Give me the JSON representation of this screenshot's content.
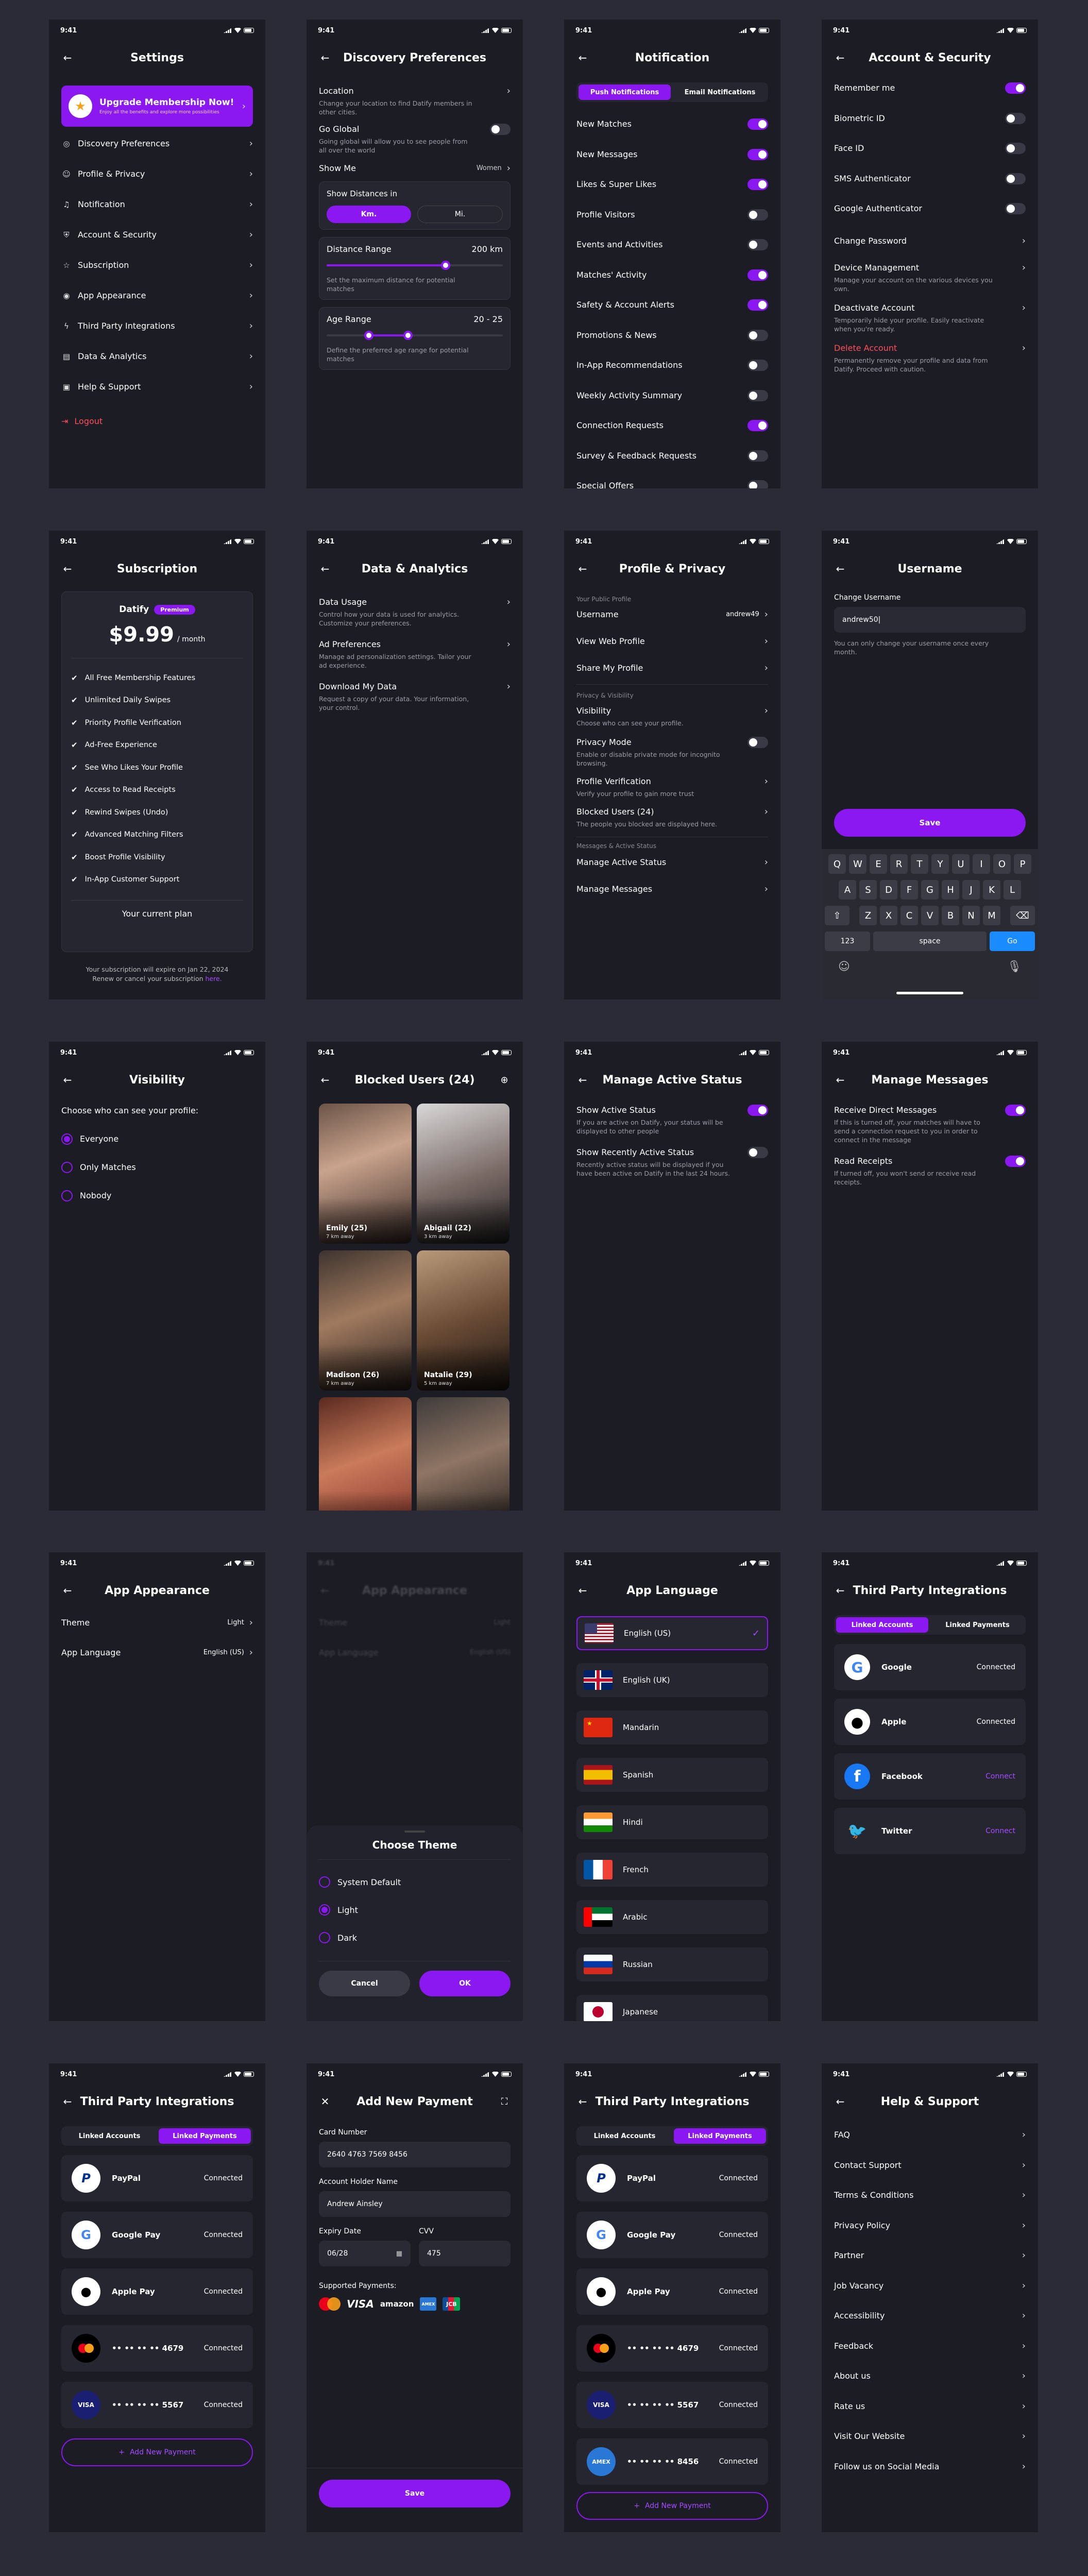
{
  "status_time": "9:41",
  "s1": {
    "title": "Settings",
    "promo_title": "Upgrade Membership Now!",
    "promo_sub": "Enjoy all the benefits and explore more possibilities",
    "items": [
      {
        "label": "Discovery Preferences",
        "icon": "compass-icon"
      },
      {
        "label": "Profile & Privacy",
        "icon": "user-icon"
      },
      {
        "label": "Notification",
        "icon": "bell-icon"
      },
      {
        "label": "Account & Security",
        "icon": "shield-icon"
      },
      {
        "label": "Subscription",
        "icon": "star-icon"
      },
      {
        "label": "App Appearance",
        "icon": "eye-icon"
      },
      {
        "label": "Third Party Integrations",
        "icon": "bolt-icon"
      },
      {
        "label": "Data & Analytics",
        "icon": "chart-icon"
      },
      {
        "label": "Help & Support",
        "icon": "doc-icon"
      }
    ],
    "logout": "Logout"
  },
  "s2": {
    "title": "Discovery Preferences",
    "loc_label": "Location",
    "loc_sub": "Change your location to find Datify members in other cities.",
    "global_label": "Go Global",
    "global_sub": "Going global will allow you to see people from all over the world",
    "showme_label": "Show Me",
    "showme_value": "Women",
    "dist_title": "Show Distances in",
    "km": "Km.",
    "mi": "Mi.",
    "range_label": "Distance Range",
    "range_value": "200 km",
    "range_sub": "Set the maximum distance for potential matches",
    "range_fill": 0.73,
    "age_label": "Age Range",
    "age_value": "20 - 25",
    "age_sub": "Define the preferred age range for potential matches",
    "age_lo": 0.26,
    "age_hi": 0.5
  },
  "s3": {
    "title": "Notification",
    "tab_push": "Push Notifications",
    "tab_email": "Email Notifications",
    "items": [
      {
        "label": "New Matches",
        "on": true
      },
      {
        "label": "New Messages",
        "on": true
      },
      {
        "label": "Likes & Super Likes",
        "on": true
      },
      {
        "label": "Profile Visitors",
        "on": false
      },
      {
        "label": "Events and Activities",
        "on": false
      },
      {
        "label": "Matches' Activity",
        "on": true
      },
      {
        "label": "Safety & Account Alerts",
        "on": true
      },
      {
        "label": "Promotions & News",
        "on": false
      },
      {
        "label": "In-App Recommendations",
        "on": false
      },
      {
        "label": "Weekly Activity Summary",
        "on": false
      },
      {
        "label": "Connection Requests",
        "on": true
      },
      {
        "label": "Survey & Feedback Requests",
        "on": false
      },
      {
        "label": "Special Offers",
        "on": false
      }
    ]
  },
  "s4": {
    "title": "Account & Security",
    "toggles": [
      {
        "label": "Remember me",
        "on": true
      },
      {
        "label": "Biometric ID",
        "on": false
      },
      {
        "label": "Face ID",
        "on": false
      },
      {
        "label": "SMS Authenticator",
        "on": false
      },
      {
        "label": "Google Authenticator",
        "on": false
      }
    ],
    "change_pw": "Change Password",
    "device_label": "Device Management",
    "device_sub": "Manage your account on the various devices you own.",
    "deact_label": "Deactivate Account",
    "deact_sub": "Temporarily hide your profile. Easily reactivate when you're ready.",
    "delete_label": "Delete Account",
    "delete_sub": "Permanently remove your profile and data from Datify. Proceed with caution."
  },
  "s5": {
    "title": "Subscription",
    "brand": "Datify",
    "badge": "Premium",
    "price": "$9.99",
    "period": "/ month",
    "features": [
      "All Free Membership Features",
      "Unlimited Daily Swipes",
      "Priority Profile Verification",
      "Ad-Free Experience",
      "See Who Likes Your Profile",
      "Access to Read Receipts",
      "Rewind Swipes (Undo)",
      "Advanced Matching Filters",
      "Boost Profile Visibility",
      "In-App Customer Support"
    ],
    "current": "Your current plan",
    "expire": "Your subscription will expire on Jan 22, 2024",
    "renew_pre": "Renew or cancel your subscription ",
    "renew_link": "here."
  },
  "s6": {
    "title": "Data & Analytics",
    "items": [
      {
        "label": "Data Usage",
        "sub": "Control how your data is used for analytics. Customize your preferences."
      },
      {
        "label": "Ad Preferences",
        "sub": "Manage ad personalization settings. Tailor your ad experience."
      },
      {
        "label": "Download My Data",
        "sub": "Request a copy of your data. Your information, your control."
      }
    ]
  },
  "s7": {
    "title": "Profile & Privacy",
    "sec1": "Your Public Profile",
    "username_label": "Username",
    "username_value": "andrew49",
    "web_label": "View Web Profile",
    "share_label": "Share My Profile",
    "sec2": "Privacy & Visibility",
    "vis_label": "Visibility",
    "vis_sub": "Choose who can see your profile.",
    "pm_label": "Privacy Mode",
    "pm_sub": "Enable or disable private mode for incognito browsing.",
    "pv_label": "Profile Verification",
    "pv_sub": "Verify your profile to gain more trust",
    "bu_label": "Blocked Users (24)",
    "bu_sub": "The people you blocked are displayed here.",
    "sec3": "Messages & Active Status",
    "mas_label": "Manage Active Status",
    "mm_label": "Manage Messages"
  },
  "s8": {
    "title": "Username",
    "label": "Change Username",
    "value": "andrew50|",
    "note": "You can only change your username once every month.",
    "save": "Save",
    "row1": [
      "Q",
      "W",
      "E",
      "R",
      "T",
      "Y",
      "U",
      "I",
      "O",
      "P"
    ],
    "row2": [
      "A",
      "S",
      "D",
      "F",
      "G",
      "H",
      "J",
      "K",
      "L"
    ],
    "row3": [
      "Z",
      "X",
      "C",
      "V",
      "B",
      "N",
      "M"
    ],
    "k123": "123",
    "space": "space",
    "go": "Go"
  },
  "s9": {
    "title": "Visibility",
    "question": "Choose who can see your profile:",
    "options": [
      {
        "label": "Everyone",
        "on": true
      },
      {
        "label": "Only Matches",
        "on": false
      },
      {
        "label": "Nobody",
        "on": false
      }
    ]
  },
  "s10": {
    "title": "Blocked Users (24)",
    "people": [
      {
        "name": "Emily (25)",
        "dist": "7 km away"
      },
      {
        "name": "Abigail (22)",
        "dist": "3 km away"
      },
      {
        "name": "Madison (26)",
        "dist": "7 km away"
      },
      {
        "name": "Natalie (29)",
        "dist": "5 km away"
      },
      {
        "name": "",
        "dist": ""
      },
      {
        "name": "",
        "dist": ""
      }
    ]
  },
  "s11": {
    "title": "Manage Active Status",
    "a_label": "Show Active Status",
    "a_sub": "If you are active on Datify, your status will be displayed to other people",
    "b_label": "Show Recently Active Status",
    "b_sub": "Recently active status will be displayed if you have been active on Datify in the last 24 hours."
  },
  "s12": {
    "title": "Manage Messages",
    "a_label": "Receive Direct Messages",
    "a_sub": "If this is turned off, your matches will have to send a connection request to you in order to connect in the message",
    "b_label": "Read Receipts",
    "b_sub": "If turned off, you won't send or receive read receipts."
  },
  "s13": {
    "title": "App Appearance",
    "theme_label": "Theme",
    "theme_value": "Light",
    "lang_label": "App Language",
    "lang_value": "English (US)"
  },
  "s14": {
    "title": "App Appearance",
    "theme_label": "Theme",
    "theme_value": "Light",
    "lang_label": "App Language",
    "lang_value": "English (US)",
    "sheet_title": "Choose Theme",
    "options": [
      {
        "label": "System Default",
        "on": false
      },
      {
        "label": "Light",
        "on": true
      },
      {
        "label": "Dark",
        "on": false
      }
    ],
    "cancel": "Cancel",
    "ok": "OK"
  },
  "s15": {
    "title": "App Language",
    "langs": [
      "English (US)",
      "English (UK)",
      "Mandarin",
      "Spanish",
      "Hindi",
      "French",
      "Arabic",
      "Russian",
      "Japanese"
    ]
  },
  "s16": {
    "title": "Third Party Integrations",
    "tab_a": "Linked Accounts",
    "tab_b": "Linked Payments",
    "items": [
      {
        "name": "Google",
        "status": "Connected"
      },
      {
        "name": "Apple",
        "status": "Connected"
      },
      {
        "name": "Facebook",
        "status": "Connect"
      },
      {
        "name": "Twitter",
        "status": "Connect"
      }
    ]
  },
  "s17": {
    "title": "Third Party Integrations",
    "tab_a": "Linked Accounts",
    "tab_b": "Linked Payments",
    "items": [
      {
        "name": "PayPal",
        "status": "Connected"
      },
      {
        "name": "Google Pay",
        "status": "Connected"
      },
      {
        "name": "Apple Pay",
        "status": "Connected"
      },
      {
        "name": "•• •• •• •• 4679",
        "status": "Connected"
      },
      {
        "name": "•• •• •• •• 5567",
        "status": "Connected"
      }
    ],
    "add": "Add New Payment"
  },
  "s18": {
    "title": "Add New Payment",
    "card_label": "Card Number",
    "card_value": "2640 4763 7569 8456",
    "holder_label": "Account Holder Name",
    "holder_value": "Andrew Ainsley",
    "exp_label": "Expiry Date",
    "exp_value": "06/28",
    "cvv_label": "CVV",
    "cvv_value": "475",
    "supported": "Supported Payments:",
    "visa": "VISA",
    "amazon": "amazon",
    "amex": "AMEX",
    "jcb": "JCB",
    "save": "Save"
  },
  "s19": {
    "title": "Third Party Integrations",
    "tab_a": "Linked Accounts",
    "tab_b": "Linked Payments",
    "items": [
      {
        "name": "PayPal",
        "status": "Connected"
      },
      {
        "name": "Google Pay",
        "status": "Connected"
      },
      {
        "name": "Apple Pay",
        "status": "Connected"
      },
      {
        "name": "•• •• •• •• 4679",
        "status": "Connected"
      },
      {
        "name": "•• •• •• •• 5567",
        "status": "Connected"
      },
      {
        "name": "•• •• •• •• 8456",
        "status": "Connected"
      }
    ],
    "add": "Add New Payment"
  },
  "s20": {
    "title": "Help & Support",
    "items": [
      "FAQ",
      "Contact Support",
      "Terms & Conditions",
      "Privacy Policy",
      "Partner",
      "Job Vacancy",
      "Accessibility",
      "Feedback",
      "About us",
      "Rate us",
      "Visit Our Website",
      "Follow us on Social Media"
    ]
  },
  "colors": {
    "accent": "#8b18f0",
    "bg": "#1c1c25",
    "card": "#262631",
    "danger": "#ff4d5a"
  }
}
